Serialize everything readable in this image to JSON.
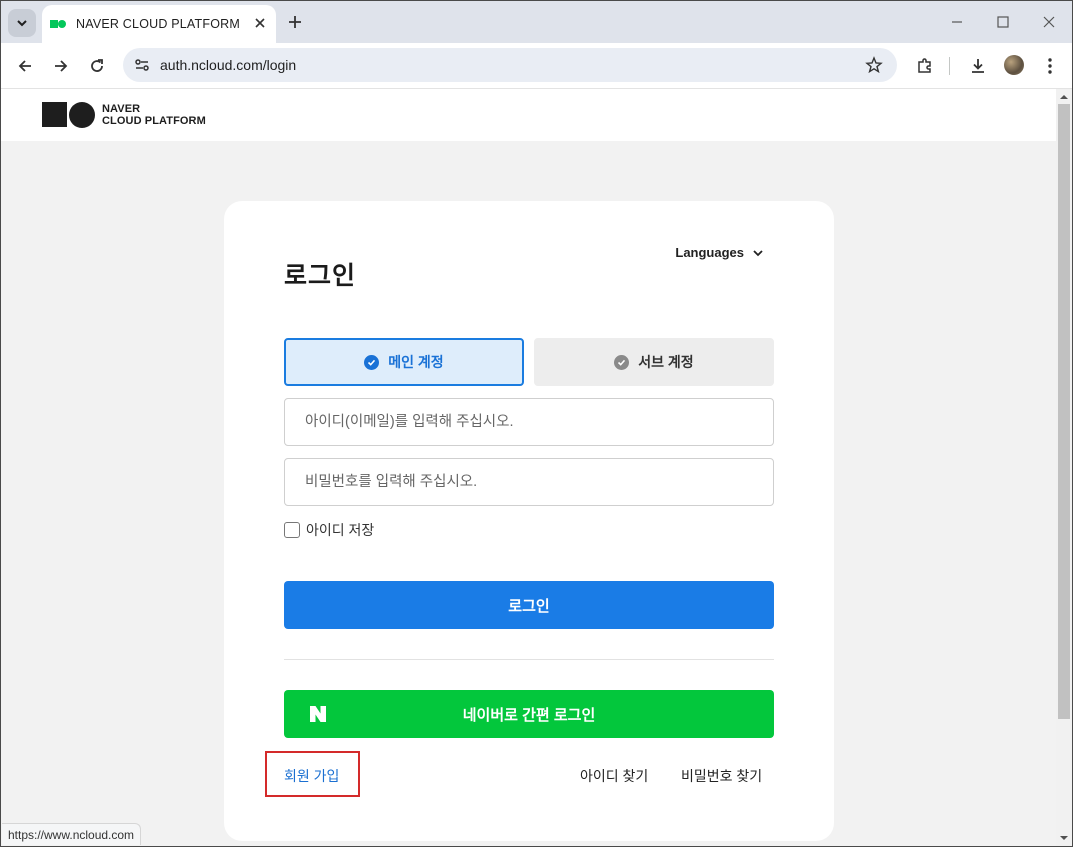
{
  "browser": {
    "tab_title": "NAVER CLOUD PLATFORM",
    "url": "auth.ncloud.com/login",
    "status_url": "https://www.ncloud.com"
  },
  "header": {
    "logo_line1": "NAVER",
    "logo_line2": "CLOUD PLATFORM"
  },
  "login": {
    "languages_label": "Languages",
    "title": "로그인",
    "tab_main": "메인 계정",
    "tab_sub": "서브 계정",
    "id_placeholder": "아이디(이메일)를 입력해 주십시오.",
    "pw_placeholder": "비밀번호를 입력해 주십시오.",
    "remember_label": "아이디 저장",
    "login_button": "로그인",
    "naver_button": "네이버로 간편 로그인",
    "signup_link": "회원 가입",
    "find_id_link": "아이디 찾기",
    "find_pw_link": "비밀번호 찾기"
  },
  "colors": {
    "primary": "#1a7ce6",
    "naver_green": "#03c73c",
    "highlight_box": "#d42a2a"
  }
}
